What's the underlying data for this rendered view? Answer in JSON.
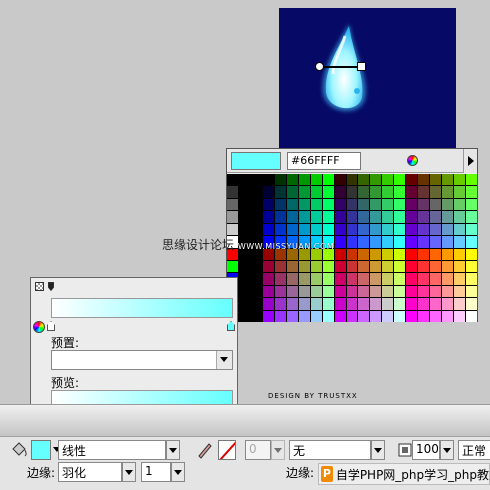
{
  "swatches": {
    "hex_value": "#66FFFF",
    "current_color": "#66ffff"
  },
  "watermark": {
    "text": "思缘设计论坛",
    "url": "WWW.MISSYUAN.COM"
  },
  "gradient_panel": {
    "preset_label": "预置:",
    "preview_label": "预览:",
    "start_color": "#ffffff",
    "end_color": "#66ffff"
  },
  "credit": "DESIGN BY TRUSTXX",
  "property_bar": {
    "fill_type": "线性",
    "stroke_width": "0",
    "stroke_type": "无",
    "opacity": "100",
    "blend_mode": "正常",
    "edge_label": "边缘:",
    "edge_mode": "羽化",
    "edge_value": "1",
    "edge_label_2": "边缘:"
  },
  "php_badge": {
    "logo": "P",
    "text": "自学PHP网_php学习_php教"
  },
  "icons": [
    "paint-bucket-icon",
    "pencil-icon",
    "color-wheel-icon",
    "swatch-menu-arrow-icon",
    "gradient-stop-icon",
    "checker-square-icon",
    "pointer-icon"
  ]
}
